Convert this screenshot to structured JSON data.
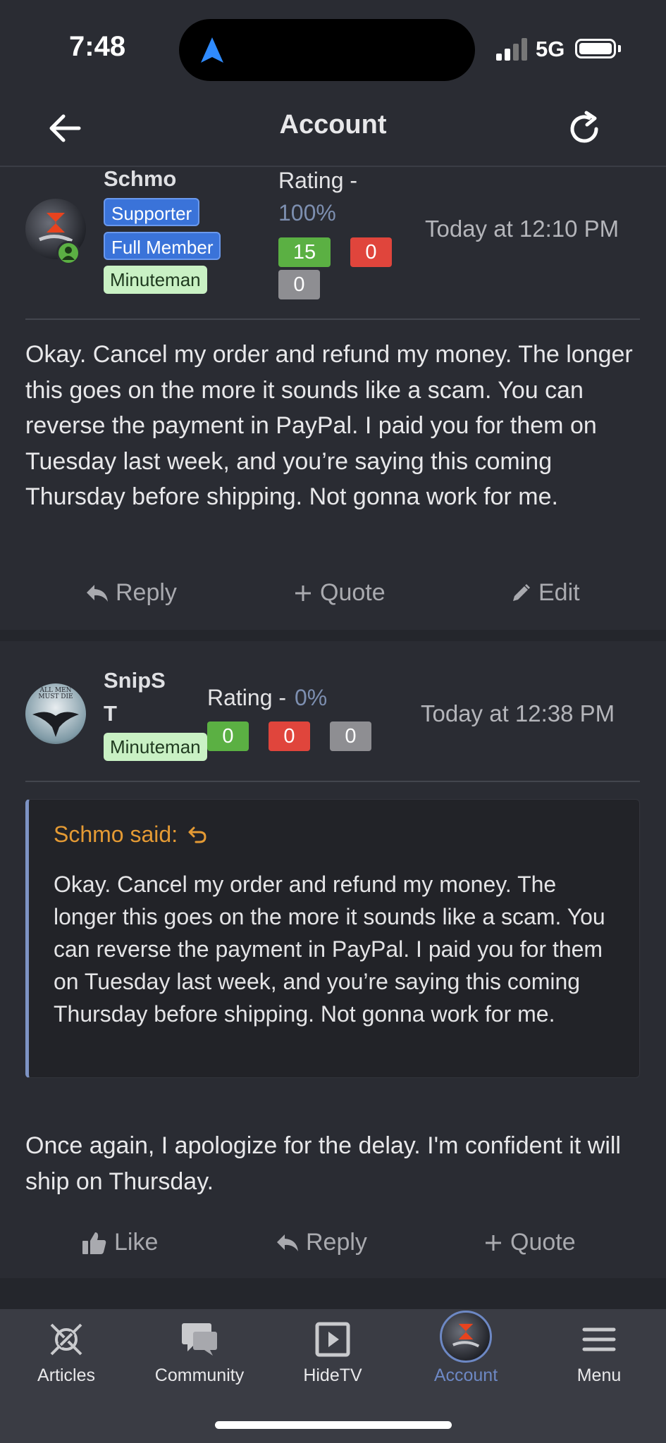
{
  "status_bar": {
    "time": "7:48",
    "network": "5G"
  },
  "header": {
    "title": "Account"
  },
  "posts": [
    {
      "username": "Schmo",
      "badges": [
        "Supporter",
        "Full Member",
        "Minuteman"
      ],
      "rating_label": "Rating -",
      "rating_percent": "100%",
      "positive": "15",
      "negative": "0",
      "neutral": "0",
      "timestamp": "Today at 12:10 PM",
      "body": "Okay. Cancel my order and refund my money. The longer this goes on the more it sounds like a scam. You can reverse the payment in PayPal. I paid you for them on Tuesday last week, and you’re saying this coming Thursday before shipping. Not gonna work for me.",
      "actions": [
        "Reply",
        "Quote",
        "Edit"
      ]
    },
    {
      "username_line1": "SnipS",
      "username_line2": "T",
      "badges": [
        "Minuteman"
      ],
      "rating_label": "Rating -",
      "rating_percent": "0%",
      "positive": "0",
      "negative": "0",
      "neutral": "0",
      "timestamp": "Today at 12:38 PM",
      "quote": {
        "author": "Schmo said:",
        "text": "Okay. Cancel my order and refund my money. The longer this goes on the more it sounds like a scam. You can reverse the payment in PayPal. I paid you for them on Tuesday last week, and you’re saying this coming Thursday before shipping. Not gonna work for me."
      },
      "body": "Once again, I apologize for the delay. I'm confident it will ship on Thursday.",
      "actions": [
        "Like",
        "Reply",
        "Quote"
      ]
    }
  ],
  "avatar_text": "ALL MEN MUST DIE",
  "bottom_nav": [
    {
      "label": "Articles"
    },
    {
      "label": "Community"
    },
    {
      "label": "HideTV"
    },
    {
      "label": "Account"
    },
    {
      "label": "Menu"
    }
  ],
  "colors": {
    "accent": "#6d88c4",
    "quote_author": "#e49a34",
    "background": "#2a2c33"
  }
}
